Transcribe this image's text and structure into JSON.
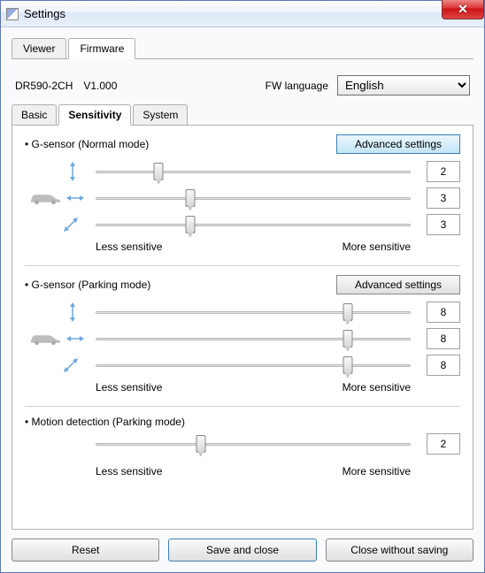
{
  "window": {
    "title": "Settings"
  },
  "top_tabs": [
    {
      "label": "Viewer",
      "active": false
    },
    {
      "label": "Firmware",
      "active": true
    }
  ],
  "fw_info": {
    "model": "DR590-2CH",
    "version": "V1.000",
    "language_label": "FW language",
    "language_value": "English"
  },
  "sub_tabs": [
    {
      "label": "Basic",
      "active": false
    },
    {
      "label": "Sensitivity",
      "active": true
    },
    {
      "label": "System",
      "active": false
    }
  ],
  "sections": {
    "normal": {
      "title": "• G-sensor (Normal mode)",
      "adv_label": "Advanced settings",
      "adv_active": true,
      "sliders": [
        {
          "axis": "updown",
          "value": 2,
          "max": 10
        },
        {
          "axis": "leftright",
          "value": 3,
          "max": 10
        },
        {
          "axis": "diag",
          "value": 3,
          "max": 10
        }
      ]
    },
    "parking": {
      "title": "• G-sensor (Parking mode)",
      "adv_label": "Advanced settings",
      "adv_active": false,
      "sliders": [
        {
          "axis": "updown",
          "value": 8,
          "max": 10
        },
        {
          "axis": "leftright",
          "value": 8,
          "max": 10
        },
        {
          "axis": "diag",
          "value": 8,
          "max": 10
        }
      ]
    },
    "motion": {
      "title": "• Motion detection (Parking mode)",
      "value": 2,
      "max": 6
    },
    "less_label": "Less sensitive",
    "more_label": "More sensitive"
  },
  "footer": {
    "reset": "Reset",
    "save": "Save and close",
    "cancel": "Close without saving"
  }
}
